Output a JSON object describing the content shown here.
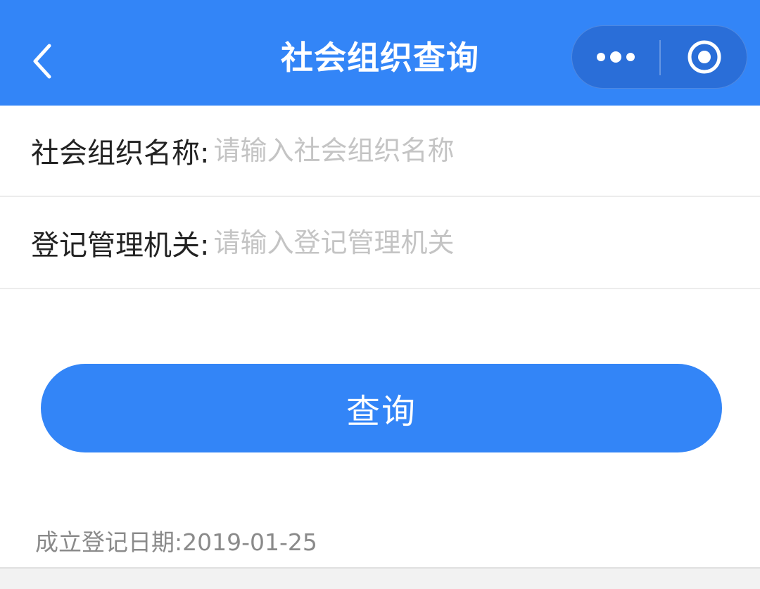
{
  "nav": {
    "title": "社会组织查询",
    "back_icon": "chevron-left-icon",
    "more_icon": "more-dots-icon",
    "close_icon": "target-circle-icon",
    "bg_color": "#3385f7"
  },
  "form": {
    "org_name": {
      "label": "社会组织名称:",
      "placeholder": "请输入社会组织名称",
      "value": ""
    },
    "authority": {
      "label": "登记管理机关:",
      "placeholder": "请输入登记管理机关",
      "value": ""
    }
  },
  "query_button": {
    "label": "查询",
    "color": "#3385f7"
  },
  "result": {
    "date_label": "成立登记日期:",
    "date_value": "2019-01-25"
  }
}
